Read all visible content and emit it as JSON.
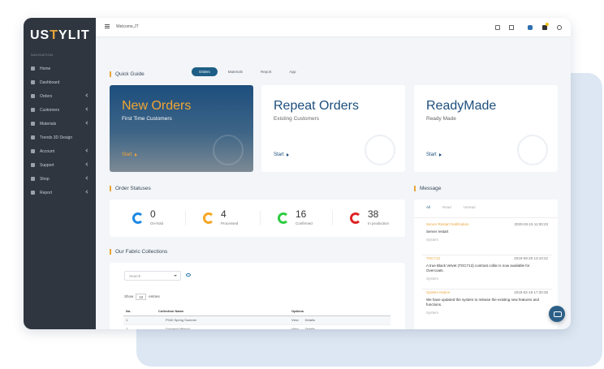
{
  "brand": {
    "logo_pre": "US",
    "logo_y": "T",
    "logo_post": "YLIT"
  },
  "sidebar": {
    "header": "NAVIGATION",
    "items": [
      {
        "label": "Home",
        "chevron": false
      },
      {
        "label": "Dashboard",
        "chevron": false
      },
      {
        "label": "Orders",
        "chevron": true
      },
      {
        "label": "Customers",
        "chevron": true
      },
      {
        "label": "Materials",
        "chevron": true
      },
      {
        "label": "Trends 3D Design",
        "chevron": false
      },
      {
        "label": "Account",
        "chevron": true
      },
      {
        "label": "Support",
        "chevron": true
      },
      {
        "label": "Shop",
        "chevron": true
      },
      {
        "label": "Report",
        "chevron": true
      }
    ]
  },
  "topbar": {
    "welcome": "Welcome,JT",
    "notif_count_1": "1",
    "notif_count_2": "1"
  },
  "quick_guide": {
    "title": "Quick Guide",
    "tabs": [
      "Orders",
      "Materials",
      "Report",
      "App"
    ],
    "active_tab": "Orders"
  },
  "cards": [
    {
      "title": "New Orders",
      "subtitle": "First Time Customers",
      "start": "Start"
    },
    {
      "title": "Repeat Orders",
      "subtitle": "Existing Customers",
      "start": "Start"
    },
    {
      "title": "ReadyMade",
      "subtitle": "Ready Made",
      "start": "Start"
    }
  ],
  "order_statuses": {
    "title": "Order Statuses",
    "items": [
      {
        "count": "0",
        "label": "On-hold",
        "color": "#1e88e5"
      },
      {
        "count": "4",
        "label": "Processed",
        "color": "#f5a623"
      },
      {
        "count": "16",
        "label": "Confirmed",
        "color": "#2ecc40"
      },
      {
        "count": "38",
        "label": "In production",
        "color": "#e02424"
      }
    ]
  },
  "fabric": {
    "title": "Our Fabric Collections",
    "search_placeholder": "Search",
    "show_label": "Show",
    "show_value": "10",
    "entries_label": "entries",
    "columns": [
      "No.",
      "Collection Name",
      "Options"
    ],
    "rows": [
      {
        "no": "1",
        "name": "P040 Spring Summer",
        "view": "View",
        "details": "Details"
      },
      {
        "no": "2",
        "name": "Dormeuil Milano!",
        "view": "View",
        "details": "Details"
      },
      {
        "no": "3",
        "name": "Reda Milano Jacketing",
        "view": "View",
        "details": "Details"
      }
    ]
  },
  "messages": {
    "title": "Message",
    "tabs": [
      "All",
      "Read",
      "Unread"
    ],
    "items": [
      {
        "title": "Server Restart Notification",
        "date": "2020-03-15 11:00:23",
        "body": "Server restart",
        "from": "System"
      },
      {
        "title": "TOC713",
        "date": "2019-09-20 13:10:22",
        "body": "A true Black Velvet (TOC713) contrast collar is now available for Overcoats.",
        "from": "System"
      },
      {
        "title": "System Notice",
        "date": "2019-02-19 17:30:35",
        "body": "We have updated the system to release the existing new features and functions.",
        "from": "System"
      }
    ]
  },
  "colors": {
    "accent": "#e9a53a",
    "brand": "#1e5e86",
    "sidebar": "#2f3640"
  },
  "icons": [
    "grid-icon",
    "fullscreen-icon",
    "bell-icon",
    "cart-icon",
    "power-icon",
    "eye-icon",
    "chat-icon"
  ]
}
